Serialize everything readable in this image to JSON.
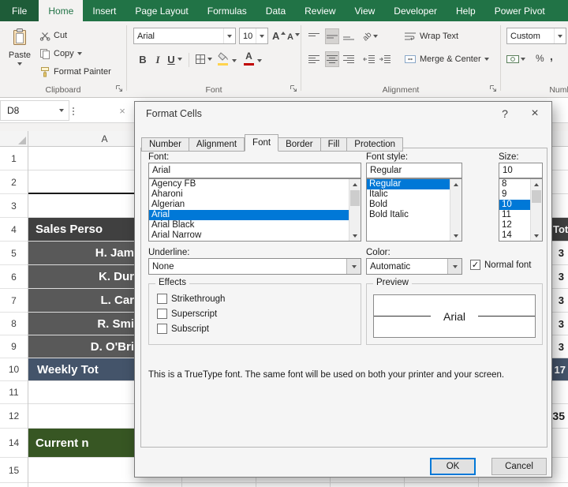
{
  "ribbon": {
    "tabs": [
      "File",
      "Home",
      "Insert",
      "Page Layout",
      "Formulas",
      "Data",
      "Review",
      "View",
      "Developer",
      "Help",
      "Power Pivot"
    ],
    "active_tab": "Home",
    "groups": {
      "clipboard": {
        "label": "Clipboard",
        "paste": "Paste",
        "cut": "Cut",
        "copy": "Copy",
        "format_painter": "Format Painter"
      },
      "font": {
        "label": "Font",
        "name_value": "Arial",
        "size_value": "10",
        "bold": "B",
        "italic": "I",
        "underline": "U",
        "grow": "A",
        "shrink": "A"
      },
      "alignment": {
        "label": "Alignment",
        "wrap_text": "Wrap Text",
        "merge_center": "Merge & Center",
        "orientation": "ab"
      },
      "number": {
        "label": "Number",
        "format_value": "Custom",
        "percent": "%",
        "comma": ","
      }
    }
  },
  "formula_bar": {
    "name_box": "D8",
    "cancel": "×"
  },
  "sheet": {
    "column_a": "A",
    "row_numbers": [
      "1",
      "2",
      "3",
      "4",
      "5",
      "6",
      "7",
      "8",
      "9",
      "10",
      "11",
      "12",
      "14",
      "15"
    ],
    "cells": {
      "a4": "Sales Perso",
      "a5": "H. Jam",
      "a6": "K. Dur",
      "a7": "L. Car",
      "a8": "R. Smi",
      "a9": "D. O'Bri",
      "a10": "Weekly Tot",
      "a14": "Current n"
    },
    "right_column": {
      "r4": "Tot",
      "r5": "3",
      "r6": "3",
      "r7": "3",
      "r8": "3",
      "r9": "3",
      "r10": "17",
      "r12": "35"
    }
  },
  "dialog": {
    "title": "Format Cells",
    "help": "?",
    "close": "×",
    "tabs": [
      "Number",
      "Alignment",
      "Font",
      "Border",
      "Fill",
      "Protection"
    ],
    "active_tab": "Font",
    "font_label": "Font:",
    "font_value": "Arial",
    "font_items": [
      "Agency FB",
      "Aharoni",
      "Algerian",
      "Arial",
      "Arial Black",
      "Arial Narrow"
    ],
    "font_selected": "Arial",
    "style_label": "Font style:",
    "style_value": "Regular",
    "style_items": [
      "Regular",
      "Italic",
      "Bold",
      "Bold Italic"
    ],
    "style_selected": "Regular",
    "size_label": "Size:",
    "size_value": "10",
    "size_items": [
      "8",
      "9",
      "10",
      "11",
      "12",
      "14"
    ],
    "size_selected": "10",
    "underline_label": "Underline:",
    "underline_value": "None",
    "color_label": "Color:",
    "color_value": "Automatic",
    "normal_font_label": "Normal font",
    "normal_font_checked": true,
    "checkmark": "✓",
    "effects_label": "Effects",
    "effects_items": [
      "Strikethrough",
      "Superscript",
      "Subscript"
    ],
    "preview_label": "Preview",
    "preview_text": "Arial",
    "description": "This is a TrueType font.  The same font will be used on both your printer and your screen.",
    "ok_label": "OK",
    "cancel_label": "Cancel"
  },
  "colors": {
    "excel_green": "#217346",
    "header_row_dark": "#404040",
    "name_rows_gray": "#595959",
    "weekly_total_blue": "#44546a",
    "current_row_green": "#375623",
    "selection_blue": "#0078d7"
  }
}
